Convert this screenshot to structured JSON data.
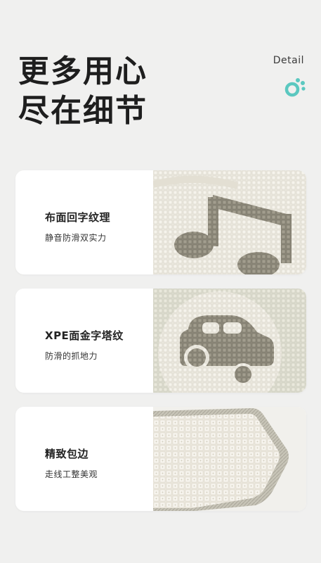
{
  "header": {
    "headline_line1": "更多用心",
    "headline_line2": "尽在细节",
    "detail_label": "Detail",
    "icon": "paw-icon",
    "accent_color": "#5bc8c0"
  },
  "cards": [
    {
      "title": "布面回字纹理",
      "subtitle": "静音防滑双实力",
      "image_icon": "music-note-icon"
    },
    {
      "title": "XPE面金字塔纹",
      "subtitle": "防滑的抓地力",
      "image_icon": "car-icon"
    },
    {
      "title": "精致包边",
      "subtitle": "走线工整美观",
      "image_icon": "mat-edge-icon"
    }
  ]
}
